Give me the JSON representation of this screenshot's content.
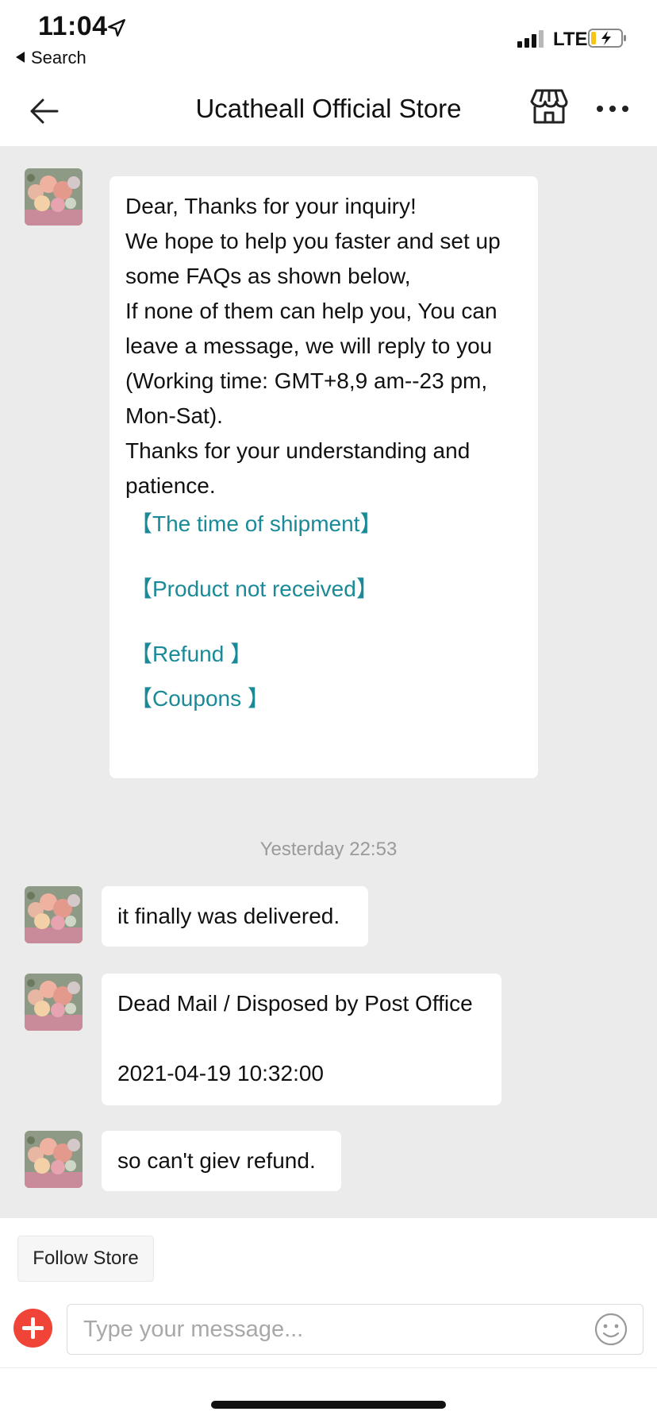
{
  "status_bar": {
    "time": "11:04",
    "back_app_label": "Search",
    "network": "LTE"
  },
  "header": {
    "title": "Ucatheall Official Store"
  },
  "messages": [
    {
      "sender": "store",
      "lines": [
        "Dear, Thanks for your inquiry!",
        "We hope to help you faster and set up some FAQs as shown below,",
        "If none of them can help you, You can leave a message, we will reply to you (Working time: GMT+8,9 am--23 pm, Mon-Sat).",
        "Thanks for your understanding and patience."
      ],
      "faq_links": [
        "【The time of shipment】",
        "【Product not received】",
        "【Refund 】",
        "【Coupons 】"
      ]
    },
    {
      "sender": "store",
      "text": "it finally was delivered."
    },
    {
      "sender": "store",
      "text": "Dead Mail / Disposed by Post Office",
      "text2": "2021-04-19 10:32:00"
    },
    {
      "sender": "store",
      "text": "so can't giev refund."
    }
  ],
  "timestamp": "Yesterday 22:53",
  "footer": {
    "follow_label": "Follow Store",
    "input_placeholder": "Type your message..."
  },
  "colors": {
    "link": "#1a8a98",
    "chat_bg": "#ebebeb",
    "plus_button": "#f04438"
  }
}
